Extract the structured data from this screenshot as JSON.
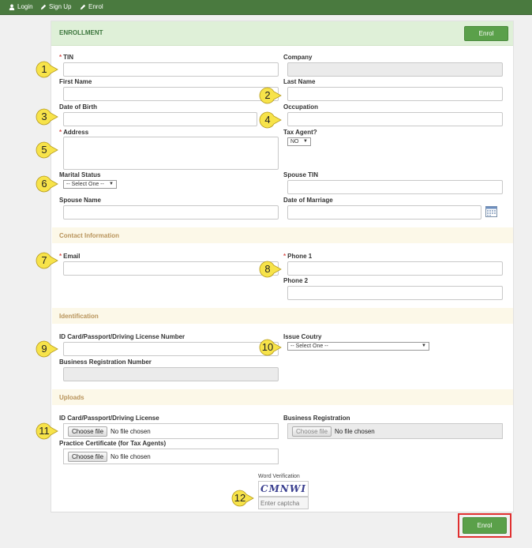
{
  "nav": {
    "login": "Login",
    "signup": "Sign Up",
    "enrol": "Enrol"
  },
  "header": {
    "title": "ENROLLMENT",
    "enrol_button": "Enrol"
  },
  "form": {
    "tin": "TIN",
    "company": "Company",
    "first_name": "First Name",
    "last_name": "Last Name",
    "dob": "Date of Birth",
    "occupation": "Occupation",
    "address": "Address",
    "tax_agent": "Tax Agent?",
    "tax_agent_value": "NO",
    "marital_status": "Marital Status",
    "marital_status_value": "-- Select One --",
    "spouse_tin": "Spouse TIN",
    "spouse_name": "Spouse Name",
    "date_of_marriage": "Date of Marriage"
  },
  "contact": {
    "section": "Contact Information",
    "email": "Email",
    "phone1": "Phone 1",
    "phone2": "Phone 2"
  },
  "identification": {
    "section": "Identification",
    "id_number": "ID Card/Passport/Driving License Number",
    "issue_country": "Issue Coutry",
    "issue_country_value": "-- Select One --",
    "brn": "Business Registration Number"
  },
  "uploads": {
    "section": "Uploads",
    "id_file": "ID Card/Passport/Driving License",
    "business_reg": "Business Registration",
    "practice_cert": "Practice Certificate (for Tax Agents)",
    "choose_file": "Choose file",
    "no_file": "No file chosen"
  },
  "captcha": {
    "label": "Word Verification",
    "image_text": "CMNWI",
    "placeholder": "Enter captcha"
  },
  "footer": {
    "enrol_button": "Enrol"
  },
  "badges": [
    "1",
    "2",
    "3",
    "4",
    "5",
    "6",
    "7",
    "8",
    "9",
    "10",
    "11",
    "12"
  ],
  "colors": {
    "nav": "#4a7a3f",
    "button": "#5aa04a",
    "header_bg": "#dff0d8",
    "section_bg": "#fcf8e8",
    "badge": "#f7e34a",
    "highlight": "#e03030"
  }
}
